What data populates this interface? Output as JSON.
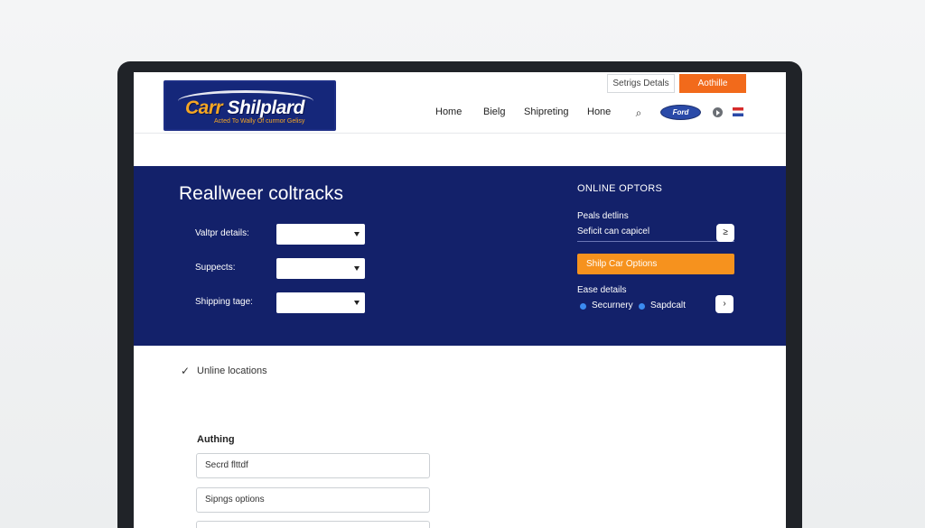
{
  "header": {
    "logo": {
      "title_part1": "Carr",
      "title_part2": "Shilplard",
      "tagline": "Acted To Wally Of curmor Gelisy"
    },
    "settings_button": "Setrigs Detals",
    "activate_button": "Aothille",
    "nav": [
      "Home",
      "Bielg",
      "Shipreting",
      "Hone"
    ],
    "brand_badge": "Ford"
  },
  "hero": {
    "title": "Reallweer coltracks",
    "form": [
      {
        "label": "Valtpr details:",
        "value": ""
      },
      {
        "label": "Suppects:",
        "value": ""
      },
      {
        "label": "Shipping tage:",
        "value": ""
      }
    ],
    "options": {
      "title": "ONLINE OPTORS",
      "peals_label": "Peals detlins",
      "select_label": "Seficit can capicel",
      "select_btn": "≥",
      "orange_button": "Shilp Car Options",
      "ease_label": "Ease details",
      "radios": [
        "Securnery",
        "Sapdcalt"
      ],
      "ease_btn": "›"
    }
  },
  "lower": {
    "online_locations": "Unline locations",
    "check_icon": "✓",
    "section_label": "Authing",
    "fields": [
      "Secrd flttdf",
      "Sipngs options",
      ""
    ]
  },
  "colors": {
    "navy": "#13216a",
    "orange": "#f6921e",
    "accent": "#f26a1b"
  }
}
